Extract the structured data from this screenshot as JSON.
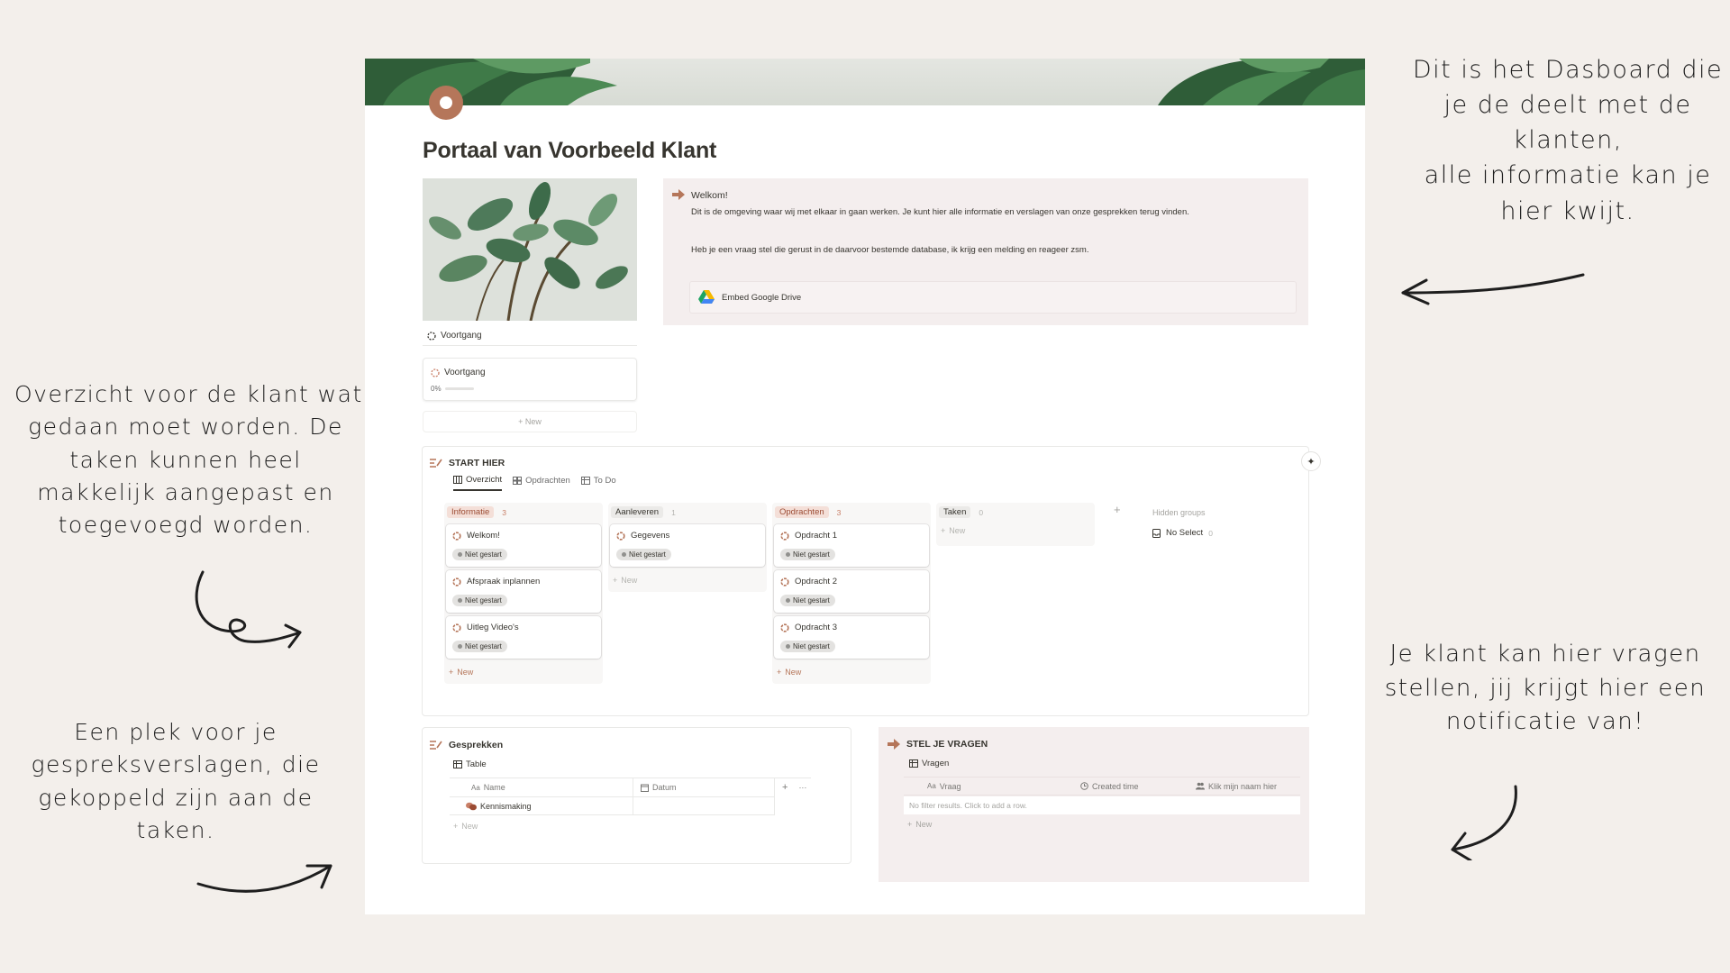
{
  "annotations": {
    "top_right": [
      "Dit is het Dasboard die",
      "je de deelt met de",
      "klanten,",
      "alle informatie kan je",
      "hier kwijt."
    ],
    "mid_left": [
      "Overzicht voor de klant wat",
      "gedaan moet worden. De",
      "taken kunnen heel",
      "makkelijk aangepast en",
      "toegevoegd worden."
    ],
    "bottom_left": [
      "Een plek voor je",
      "gespreksverslagen, die",
      "gekoppeld zijn aan de",
      "taken."
    ],
    "bottom_right": [
      "Je klant kan hier vragen",
      "stellen, jij krijgt hier een",
      "notificatie van!"
    ]
  },
  "page": {
    "title": "Portaal van Voorbeeld Klant",
    "icon": "donut-icon",
    "accent": "#b5765a"
  },
  "progress": {
    "header": "Voortgang",
    "card_title": "Voortgang",
    "percent_label": "0%",
    "percent_value": 0,
    "new_label": "+ New"
  },
  "welcome": {
    "title": "Welkom!",
    "line1": "Dit is de omgeving waar wij met elkaar in gaan werken. Je kunt hier alle informatie en verslagen van onze gesprekken terug vinden.",
    "line2": "Heb je een vraag stel die gerust in de daarvoor bestemde database, ik krijg een melding en reageer zsm.",
    "embed_label": "Embed Google Drive"
  },
  "board": {
    "title": "START HIER",
    "tabs": [
      "Overzicht",
      "Opdrachten",
      "To Do"
    ],
    "columns": [
      {
        "name": "Informatie",
        "count": "3",
        "pill_bg": "#f4dfd8",
        "pill_fg": "#9b4b33",
        "count_fg": "#c87e66",
        "cards": [
          {
            "title": "Welkom!",
            "status": "Niet gestart"
          },
          {
            "title": "Afspraak inplannen",
            "status": "Niet gestart"
          },
          {
            "title": "Uitleg Video's",
            "status": "Niet gestart"
          }
        ]
      },
      {
        "name": "Aanleveren",
        "count": "1",
        "pill_bg": "#ebeae8",
        "pill_fg": "#37352f",
        "count_fg": "#b4b4b0",
        "cards": [
          {
            "title": "Gegevens",
            "status": "Niet gestart"
          }
        ]
      },
      {
        "name": "Opdrachten",
        "count": "3",
        "pill_bg": "#f4dfd8",
        "pill_fg": "#9b4b33",
        "count_fg": "#c87e66",
        "cards": [
          {
            "title": "Opdracht 1",
            "status": "Niet gestart"
          },
          {
            "title": "Opdracht 2",
            "status": "Niet gestart"
          },
          {
            "title": "Opdracht 3",
            "status": "Niet gestart"
          }
        ]
      },
      {
        "name": "Taken",
        "count": "0",
        "pill_bg": "#ebeae8",
        "pill_fg": "#37352f",
        "count_fg": "#b4b4b0",
        "cards": []
      }
    ],
    "new_label": "New",
    "hidden_groups": "Hidden groups",
    "no_select": "No Select",
    "no_select_count": "0"
  },
  "gesprekken": {
    "title": "Gesprekken",
    "view": "Table",
    "columns": [
      "Name",
      "Datum"
    ],
    "rows": [
      {
        "name": "Kennismaking"
      }
    ],
    "new_label": "New"
  },
  "vragen": {
    "title": "STEL JE VRAGEN",
    "view": "Vragen",
    "columns": [
      "Vraag",
      "Created time",
      "Klik mijn naam hier"
    ],
    "empty": "No filter results. Click to add a row.",
    "new_label": "New"
  }
}
